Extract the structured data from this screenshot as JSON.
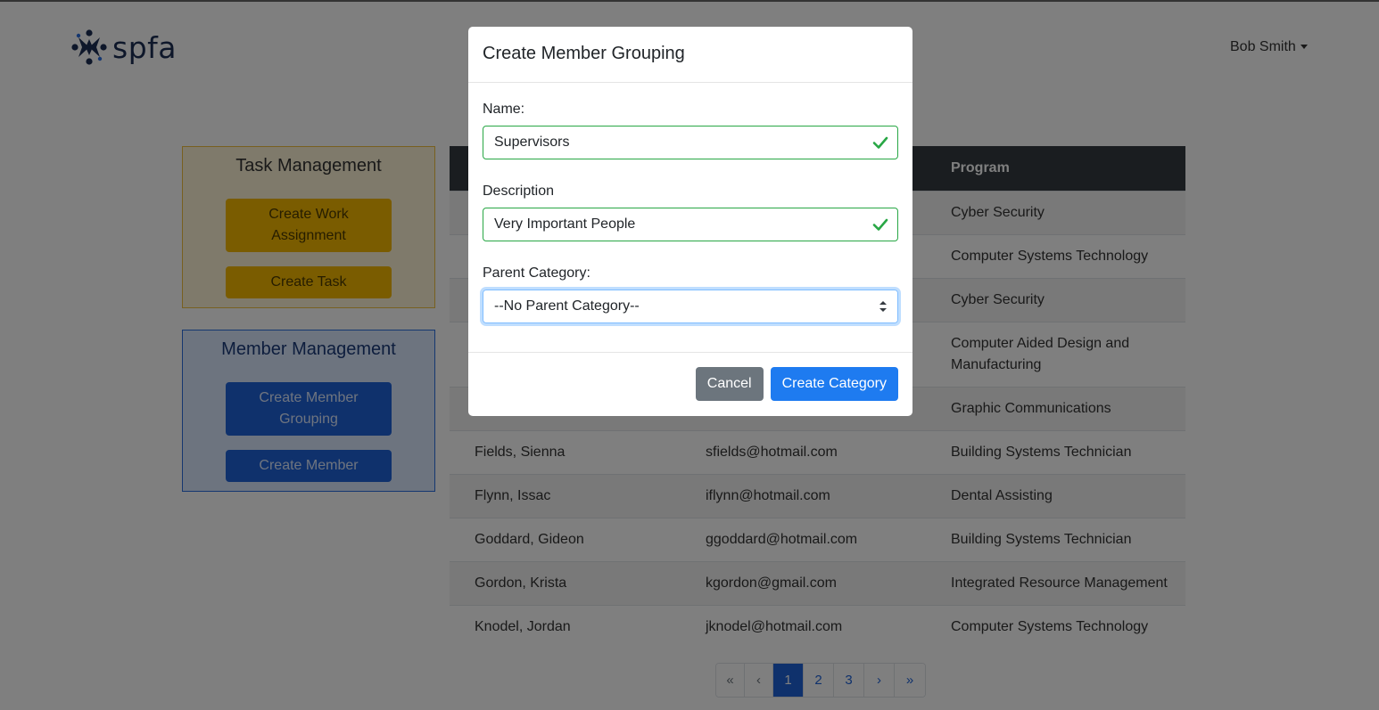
{
  "header": {
    "brand": "spfa",
    "user_name": "Bob Smith"
  },
  "task_panel": {
    "title": "Task Management",
    "buttons": [
      "Create Work Assignment",
      "Create Task"
    ]
  },
  "member_panel": {
    "title": "Member Management",
    "buttons": [
      "Create Member Grouping",
      "Create Member"
    ]
  },
  "table": {
    "headers": [
      "",
      "",
      "Program"
    ],
    "rows": [
      [
        "",
        "",
        "Cyber Security"
      ],
      [
        "",
        "",
        "Computer Systems Technology"
      ],
      [
        "",
        "",
        "Cyber Security"
      ],
      [
        "",
        "",
        "Computer Aided Design and Manufacturing"
      ],
      [
        "",
        "",
        "Graphic Communications"
      ],
      [
        "Fields, Sienna",
        "sfields@hotmail.com",
        "Building Systems Technician"
      ],
      [
        "Flynn, Issac",
        "iflynn@hotmail.com",
        "Dental Assisting"
      ],
      [
        "Goddard, Gideon",
        "ggoddard@hotmail.com",
        "Building Systems Technician"
      ],
      [
        "Gordon, Krista",
        "kgordon@gmail.com",
        "Integrated Resource Management"
      ],
      [
        "Knodel, Jordan",
        "jknodel@hotmail.com",
        "Computer Systems Technology"
      ]
    ]
  },
  "pagination": {
    "first": "«",
    "prev": "‹",
    "pages": [
      "1",
      "2",
      "3"
    ],
    "active_page": "1",
    "next": "›",
    "last": "»"
  },
  "modal": {
    "title": "Create Member Grouping",
    "name_label": "Name:",
    "name_value": "Supervisors",
    "description_label": "Description",
    "description_value": "Very Important People",
    "parent_label": "Parent Category:",
    "parent_value": "--No Parent Category--",
    "cancel_label": "Cancel",
    "submit_label": "Create Category"
  },
  "colors": {
    "valid": "#28a745",
    "primary": "#1e7bf0",
    "warning": "#f5b800",
    "brand_navy": "#1d2f55"
  },
  "icons": {
    "logo": "spfa-logo-icon",
    "valid": "check-icon",
    "select": "select-arrows-icon",
    "caret": "caret-down-icon"
  }
}
